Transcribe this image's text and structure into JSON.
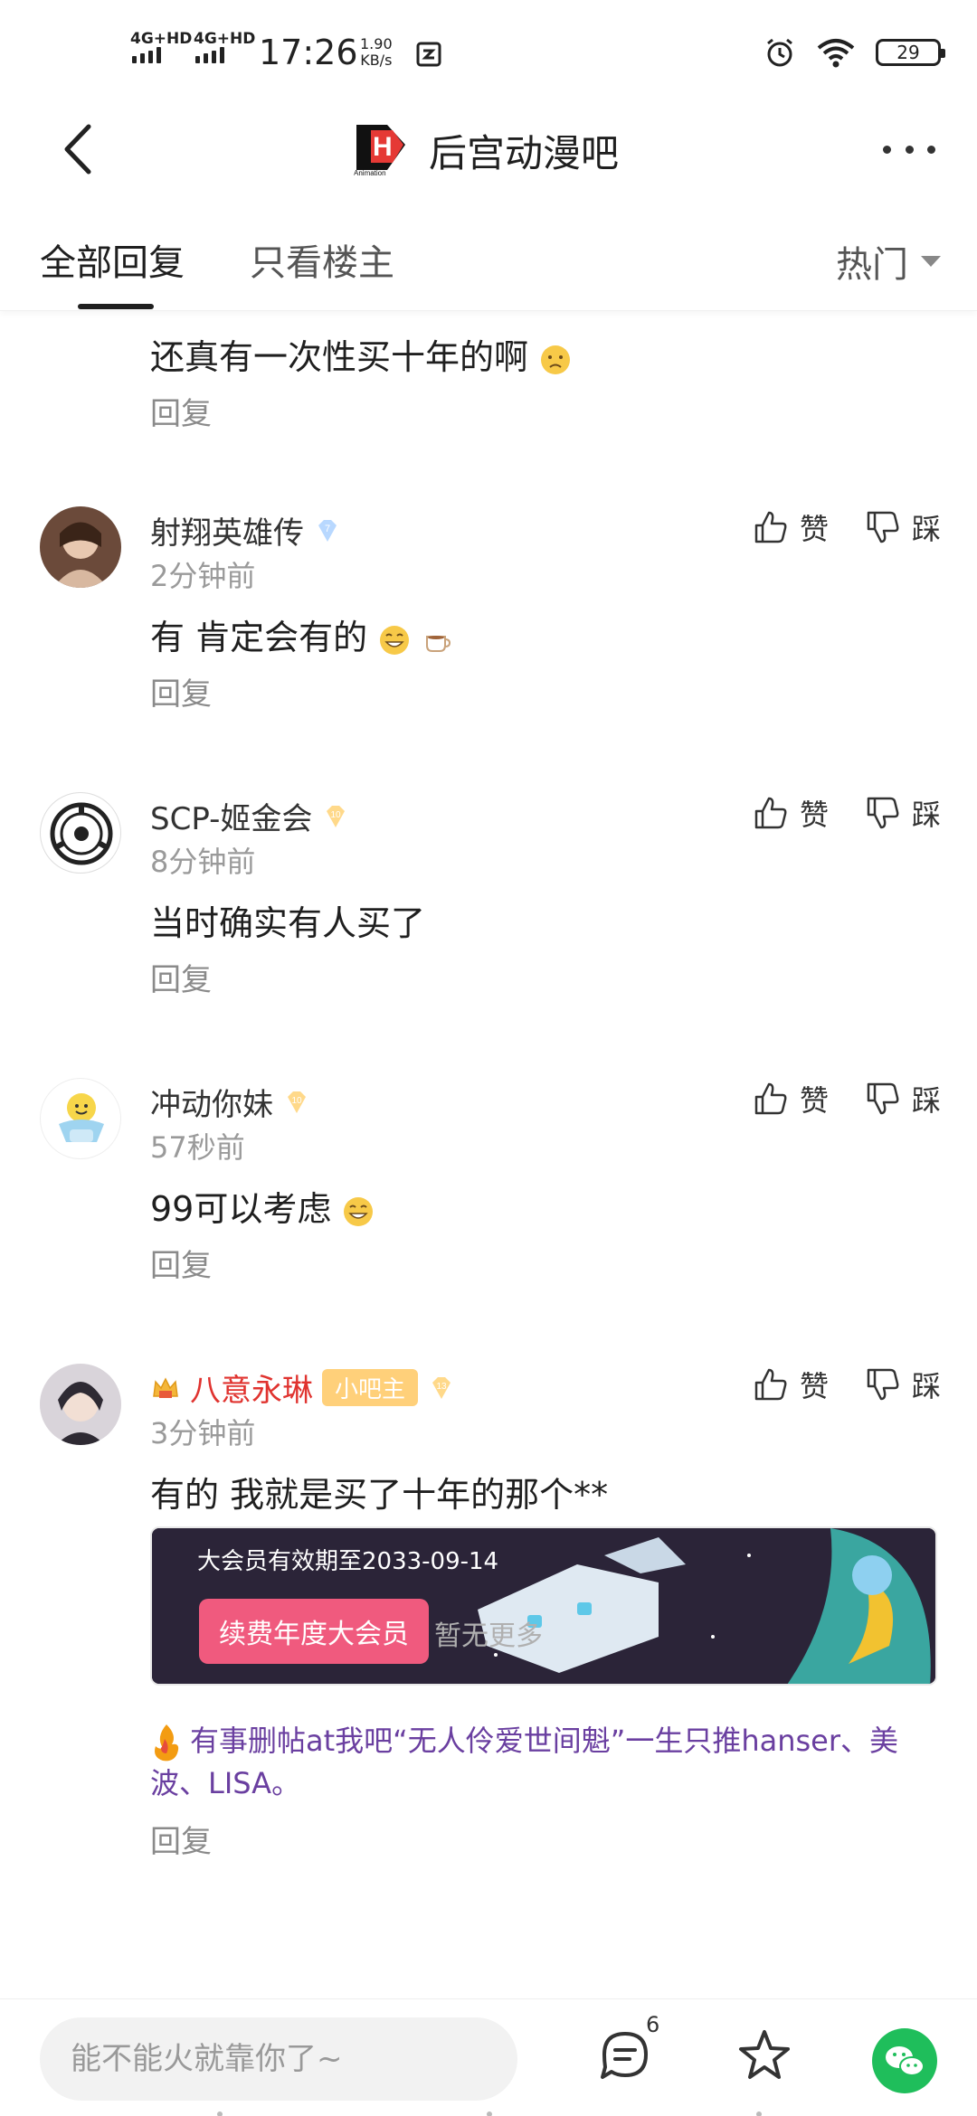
{
  "status_bar": {
    "net1": "4G+HD",
    "net2": "4G+HD",
    "time": "17:26",
    "speed_value": "1.90",
    "speed_unit": "KB/s",
    "battery": "29"
  },
  "header": {
    "forum_title": "后宫动漫吧",
    "logo_text": "Animation"
  },
  "tabs": {
    "all_replies": "全部回复",
    "owner_only": "只看楼主",
    "sort": "热门"
  },
  "partial_reply": {
    "text": "还真有一次性买十年的啊",
    "reply_label": "回复"
  },
  "comments": [
    {
      "username": "射翔英雄传",
      "level": "7",
      "time": "2分钟前",
      "text": "有 肯定会有的",
      "like_label": "赞",
      "dislike_label": "踩",
      "reply_label": "回复"
    },
    {
      "username": "SCP-姬金会",
      "level": "10",
      "time": "8分钟前",
      "text": "当时确实有人买了",
      "like_label": "赞",
      "dislike_label": "踩",
      "reply_label": "回复"
    },
    {
      "username": "冲动你妹",
      "level": "10",
      "time": "57秒前",
      "text": "99可以考虑",
      "like_label": "赞",
      "dislike_label": "踩",
      "reply_label": "回复"
    },
    {
      "username": "八意永琳",
      "badge": "小吧主",
      "level": "13",
      "time": "3分钟前",
      "text": "有的 我就是买了十年的那个**",
      "banner_text": "大会员有效期至2033-09-14",
      "banner_button": "续费年度大会员",
      "signature": "有事删帖at我吧“无人伶爱世间魁”一生只推hanser、美波、LISA。",
      "like_label": "赞",
      "dislike_label": "踩",
      "reply_label": "回复"
    }
  ],
  "no_more": "暂无更多",
  "bottom_bar": {
    "input_placeholder": "能不能火就靠你了~",
    "reply_count": "6"
  },
  "colors": {
    "owner_name": "#e0332f",
    "mod_badge": "#ffd07a",
    "signature": "#6a3fa0",
    "wechat": "#1fbe5b"
  }
}
